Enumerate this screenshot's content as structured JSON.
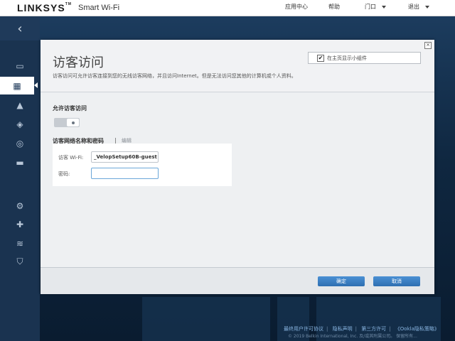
{
  "header": {
    "brand": "LINKSYS",
    "brand_tm": "TM",
    "product": "Smart Wi-Fi",
    "nav": {
      "help_center": "应用中心",
      "help": "帮助",
      "user": "门口",
      "logout": "退出"
    }
  },
  "sidebar": {
    "back_icon": "chevron-left-icon",
    "items": [
      {
        "icon": "device-list-icon",
        "glyph": "▭"
      },
      {
        "icon": "guest-access-icon",
        "glyph": "▦",
        "active": true
      },
      {
        "icon": "alert-icon",
        "glyph": "▲"
      },
      {
        "icon": "parental-control-icon",
        "glyph": "◈"
      },
      {
        "icon": "speed-test-icon",
        "glyph": "◎"
      },
      {
        "icon": "external-storage-icon",
        "glyph": "▬"
      },
      {
        "icon": "connectivity-icon",
        "glyph": "⚙"
      },
      {
        "icon": "troubleshooting-icon",
        "glyph": "✚"
      },
      {
        "icon": "wireless-icon",
        "glyph": "≋"
      },
      {
        "icon": "security-icon",
        "glyph": "⛉"
      }
    ]
  },
  "modal": {
    "title": "访客访问",
    "description": "访客访问可允许访客连接到您的无线访客网络，并且访问Internet。但是无法访问您其他的计算机或个人资料。",
    "show_widget_label": "在主页显示小组件",
    "show_widget_checked": true,
    "allow_label": "允许访客访问",
    "allow_enabled": false,
    "cred_section_label": "访客网络名称和密码",
    "separator": "|",
    "edit_label": "编辑",
    "wifi_label": "访客 Wi-Fi:",
    "wifi_value": "_VelopSetup60B-guest",
    "password_label": "密码:",
    "password_value": "",
    "ok_button": "确定",
    "cancel_button": "取消"
  },
  "footer": {
    "links": [
      "最终用户许可协议",
      "隐私声明",
      "第三方许可",
      "《Ookla隐私策略》"
    ],
    "copyright": "© 2019 Belkin International, Inc. 及/或其附属公司。 保留所有..."
  },
  "colors": {
    "accent": "#3a80c8",
    "sidebar": "#1a3350",
    "background": "#0e2236"
  }
}
